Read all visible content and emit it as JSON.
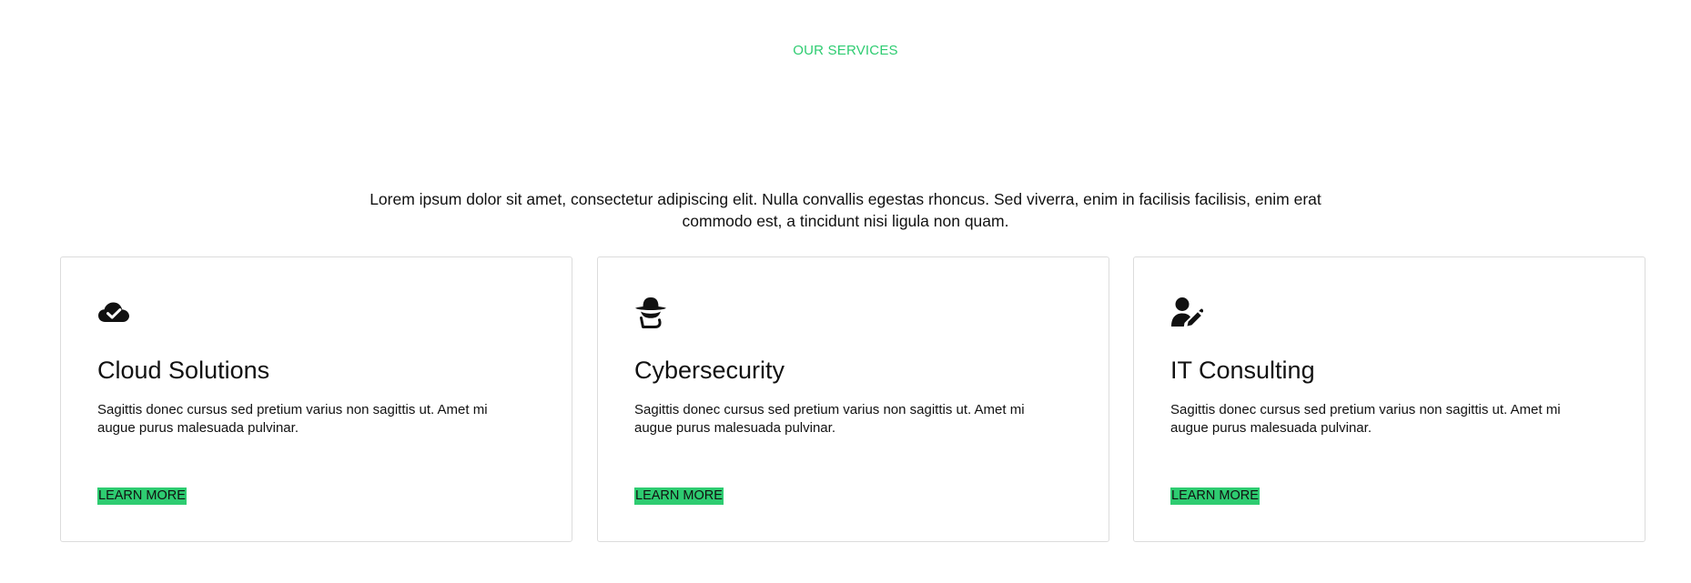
{
  "section": {
    "eyebrow": "OUR SERVICES",
    "intro": "Lorem ipsum dolor sit amet, consectetur adipiscing elit. Nulla convallis egestas rhoncus. Sed viverra, enim in facilisis facilisis, enim erat commodo est, a tincidunt nisi ligula non quam."
  },
  "colors": {
    "accent": "#2ecc71",
    "text": "#111111",
    "card_border": "#dcdcdc"
  },
  "cards": [
    {
      "icon": "cloud-check-icon",
      "title": "Cloud Solutions",
      "description": "Sagittis donec cursus sed pretium varius non sagittis ut. Amet mi augue purus malesuada pulvinar.",
      "link": "LEARN MORE"
    },
    {
      "icon": "user-secret-icon",
      "title": "Cybersecurity",
      "description": "Sagittis donec cursus sed pretium varius non sagittis ut. Amet mi augue purus malesuada pulvinar.",
      "link": "LEARN MORE"
    },
    {
      "icon": "user-edit-icon",
      "title": "IT Consulting",
      "description": "Sagittis donec cursus sed pretium varius non sagittis ut. Amet mi augue purus malesuada pulvinar.",
      "link": "LEARN MORE"
    }
  ]
}
